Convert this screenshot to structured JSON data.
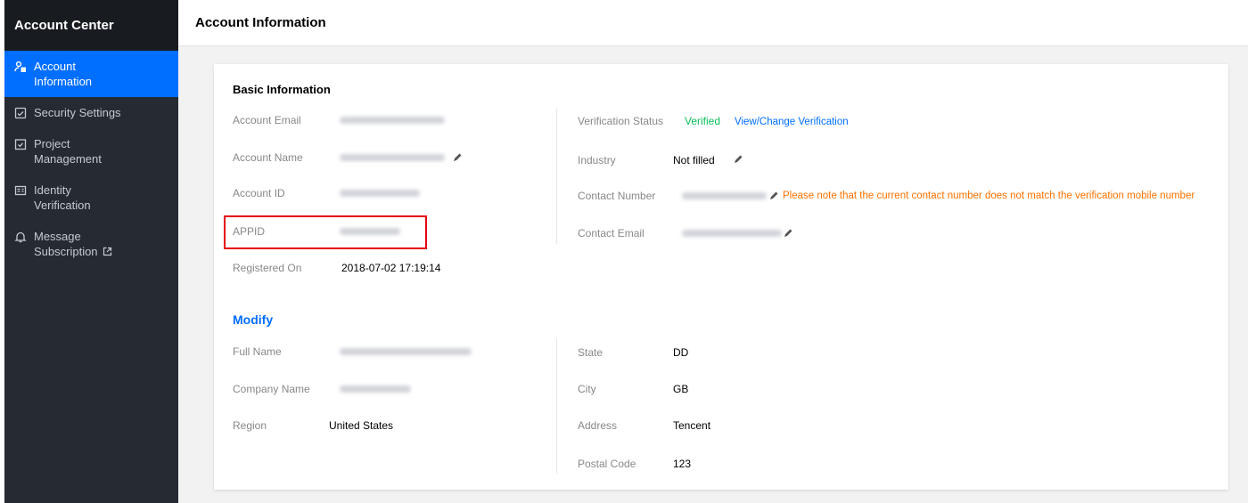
{
  "sidebar": {
    "title": "Account Center",
    "items": [
      {
        "label": "Account\nInformation",
        "icon": "user-badge-icon",
        "active": true
      },
      {
        "label": "Security Settings",
        "icon": "shield-icon",
        "active": false
      },
      {
        "label": "Project\nManagement",
        "icon": "checkbox-folder-icon",
        "active": false
      },
      {
        "label": "Identity\nVerification",
        "icon": "id-card-icon",
        "active": false
      },
      {
        "label": "Message\nSubscription",
        "icon": "bell-icon",
        "active": false,
        "external": true
      }
    ]
  },
  "header": {
    "title": "Account Information"
  },
  "basic": {
    "title": "Basic Information",
    "left": [
      {
        "label": "Account Email",
        "value": "",
        "blurred": true,
        "editable": false
      },
      {
        "label": "Account Name",
        "value": "",
        "blurred": true,
        "editable": true
      },
      {
        "label": "Account ID",
        "value": "",
        "blurred": true,
        "editable": false
      },
      {
        "label": "APPID",
        "value": "",
        "blurred": true,
        "editable": false,
        "highlighted": true
      },
      {
        "label": "Registered On",
        "value": "2018-07-02 17:19:14",
        "blurred": false,
        "editable": false
      }
    ],
    "right": [
      {
        "label": "Verification Status",
        "status": "Verified",
        "link": "View/Change Verification"
      },
      {
        "label": "Industry",
        "value": "Not filled",
        "editable": true
      },
      {
        "label": "Contact Number",
        "value": "",
        "blurred": true,
        "editable": true,
        "warning": "Please note that the current contact number does not match the verification mobile number"
      },
      {
        "label": "Contact Email",
        "value": "",
        "blurred": true,
        "editable": true
      }
    ]
  },
  "modify": {
    "title": "Modify",
    "left": [
      {
        "label": "Full Name",
        "value": "",
        "blurred": true
      },
      {
        "label": "Company Name",
        "value": "",
        "blurred": true
      },
      {
        "label": "Region",
        "value": "United States"
      }
    ],
    "right": [
      {
        "label": "State",
        "value": "DD"
      },
      {
        "label": "City",
        "value": "GB"
      },
      {
        "label": "Address",
        "value": "Tencent"
      },
      {
        "label": "Postal Code",
        "value": "123"
      }
    ]
  },
  "colors": {
    "accent": "#006eff",
    "sidebar_bg": "#262b33",
    "verified": "#0abf5b",
    "warning": "#ff7200",
    "highlight": "#e8000c"
  }
}
